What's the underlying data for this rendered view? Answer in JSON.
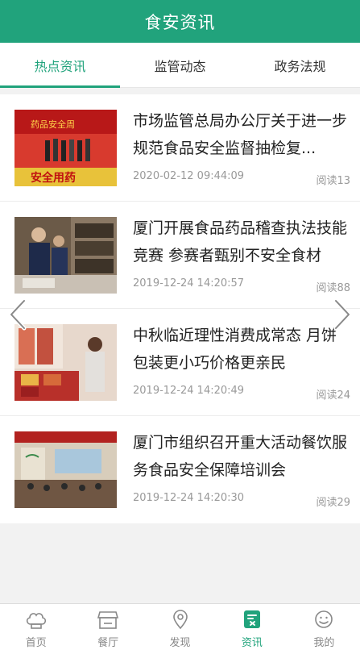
{
  "header": {
    "title": "食安资讯"
  },
  "tabs": [
    {
      "label": "热点资讯",
      "active": true
    },
    {
      "label": "监管动态",
      "active": false
    },
    {
      "label": "政务法规",
      "active": false
    }
  ],
  "news": [
    {
      "title": "市场监管总局办公厅关于进一步规范食品安全监督抽检复...",
      "date": "2020-02-12 09:44:09",
      "reads": "阅读13",
      "thumb_text": "安全用药"
    },
    {
      "title": "厦门开展食品药品稽查执法技能竞赛 参赛者甄别不安全食材",
      "date": "2019-12-24 14:20:57",
      "reads": "阅读88"
    },
    {
      "title": "中秋临近理性消费成常态 月饼包装更小巧价格更亲民",
      "date": "2019-12-24 14:20:49",
      "reads": "阅读24"
    },
    {
      "title": "厦门市组织召开重大活动餐饮服务食品安全保障培训会",
      "date": "2019-12-24 14:20:30",
      "reads": "阅读29"
    }
  ],
  "bottom_nav": [
    {
      "label": "首页",
      "icon": "chef-hat-icon",
      "active": false
    },
    {
      "label": "餐厅",
      "icon": "store-icon",
      "active": false
    },
    {
      "label": "发现",
      "icon": "location-pin-icon",
      "active": false
    },
    {
      "label": "资讯",
      "icon": "news-icon",
      "active": true
    },
    {
      "label": "我的",
      "icon": "smiley-profile-icon",
      "active": false
    }
  ],
  "colors": {
    "accent": "#21a37c",
    "inactive": "#888888"
  }
}
